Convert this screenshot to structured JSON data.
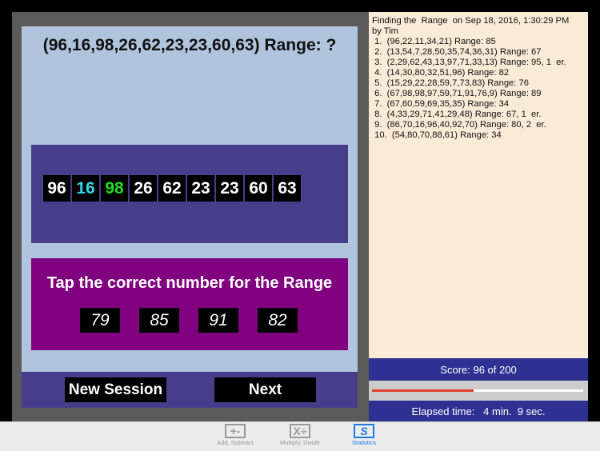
{
  "question": "(96,16,98,26,62,23,23,60,63) Range: ?",
  "numbers": [
    {
      "value": "96",
      "color": "#ffffff"
    },
    {
      "value": "16",
      "color": "#33d6e6"
    },
    {
      "value": "98",
      "color": "#22dd22"
    },
    {
      "value": "26",
      "color": "#ffffff"
    },
    {
      "value": "62",
      "color": "#ffffff"
    },
    {
      "value": "23",
      "color": "#ffffff"
    },
    {
      "value": "23",
      "color": "#ffffff"
    },
    {
      "value": "60",
      "color": "#ffffff"
    },
    {
      "value": "63",
      "color": "#ffffff"
    }
  ],
  "answer_prompt": "Tap the correct number for the Range",
  "answers": [
    "79",
    "85",
    "91",
    "82"
  ],
  "buttons": {
    "new_session": "New Session",
    "next": "Next"
  },
  "log": {
    "header": "Finding the  Range  on Sep 18, 2016, 1:30:29 PM",
    "by": "by Tim",
    "entries": [
      " 1.  (96,22,11,34,21) Range: 85",
      " 2.  (13,54,7,28,50,35,74,36,31) Range: 67",
      " 3.  (2,29,62,43,13,97,71,33,13) Range: 95, 1  er.",
      " 4.  (14,30,80,32,51,96) Range: 82",
      " 5.  (15,29,22,28,59,7,73,83) Range: 76",
      " 6.  (67,98,98,97,59,71,91,76,9) Range: 89",
      " 7.  (67,60,59,69,35,35) Range: 34",
      " 8.  (4,33,29,71,41,29,48) Range: 67, 1  er.",
      " 9.  (86,70,16,96,40,92,70) Range: 80, 2  er.",
      " 10.  (54,80,70,88,61) Range: 34"
    ]
  },
  "score": {
    "label": "Score: 96 of 200",
    "value": 96,
    "max": 200,
    "progress_color": "#e0402a"
  },
  "elapsed": "Elapsed time:   4 min.  9 sec.",
  "tabs": [
    {
      "label": "Add, Subtract",
      "icon": "+-",
      "active": false
    },
    {
      "label": "Multiply, Divide",
      "icon": "X÷",
      "active": false
    },
    {
      "label": "Statistics",
      "icon": "S",
      "active": true
    }
  ]
}
